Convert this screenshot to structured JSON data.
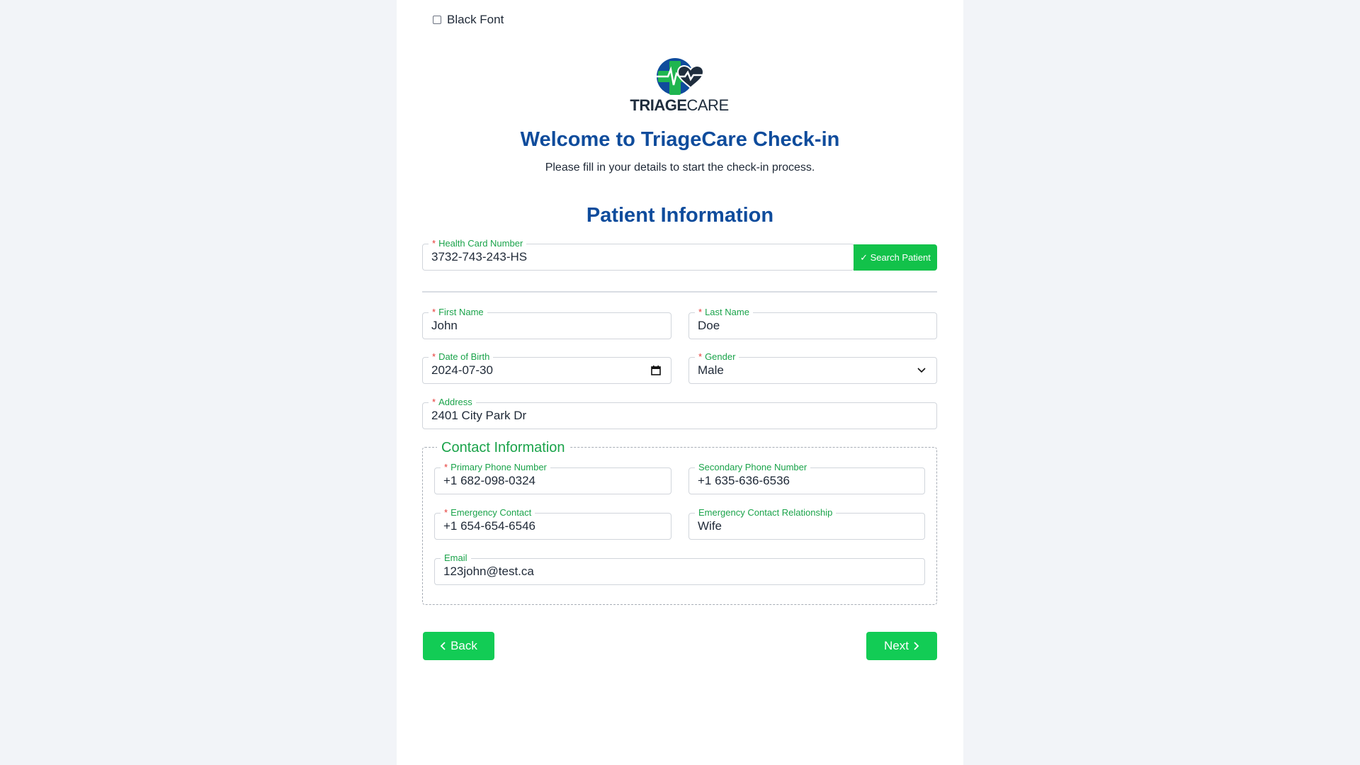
{
  "settings": {
    "black_font_label": "Black Font",
    "black_font_checked": false
  },
  "logo": {
    "text_bold": "TRIAGE",
    "text_light": "CARE"
  },
  "header": {
    "title": "Welcome to TriageCare Check-in",
    "subtitle": "Please fill in your details to start the check-in process."
  },
  "section_title": "Patient Information",
  "health_card": {
    "label": "Health Card Number",
    "value": "3732-743-243-HS",
    "search_label": "✓ Search Patient"
  },
  "patient": {
    "first_name": {
      "label": "First Name",
      "value": "John"
    },
    "last_name": {
      "label": "Last Name",
      "value": "Doe"
    },
    "dob": {
      "label": "Date of Birth",
      "value": "2024-07-30"
    },
    "gender": {
      "label": "Gender",
      "value": "Male"
    },
    "address": {
      "label": "Address",
      "value": "2401 City Park Dr"
    }
  },
  "contact": {
    "legend": "Contact Information",
    "primary_phone": {
      "label": "Primary Phone Number",
      "value": "+1 682-098-0324"
    },
    "secondary_phone": {
      "label": "Secondary Phone Number",
      "value": "+1 635-636-6536"
    },
    "emergency_contact": {
      "label": "Emergency Contact",
      "value": "+1 654-654-6546"
    },
    "emergency_relationship": {
      "label": "Emergency Contact Relationship",
      "value": "Wife"
    },
    "email": {
      "label": "Email",
      "value": "123john@test.ca"
    }
  },
  "nav": {
    "back_label": "Back",
    "next_label": "Next"
  },
  "colors": {
    "accent_green": "#12cc55",
    "heading_blue": "#0f4c9c",
    "label_green": "#1aa34a",
    "required_red": "#e53935"
  }
}
